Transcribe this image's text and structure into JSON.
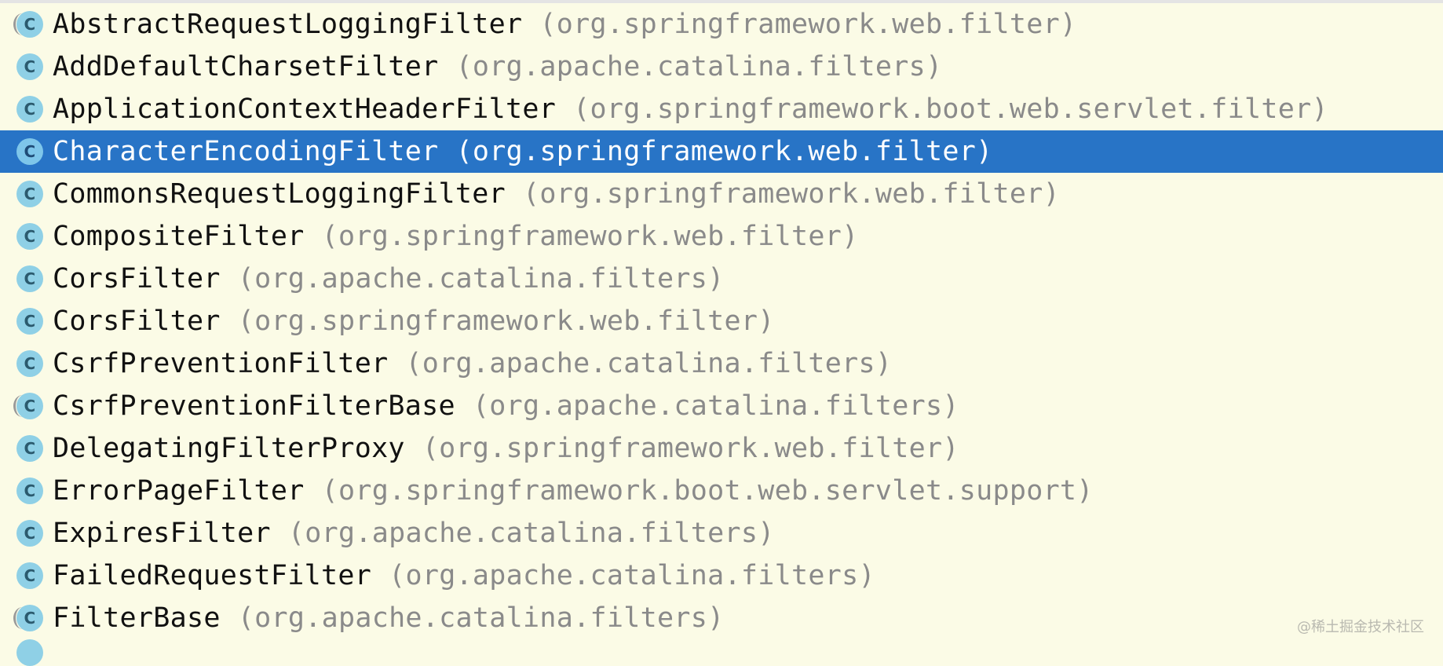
{
  "completion_popup": {
    "items": [
      {
        "icon": "class-abstract-icon",
        "icon_glyph": "C",
        "class_name": "AbstractRequestLoggingFilter",
        "package": "(org.springframework.web.filter)",
        "abstract": true
      },
      {
        "icon": "class-icon",
        "icon_glyph": "C",
        "class_name": "AddDefaultCharsetFilter",
        "package": "(org.apache.catalina.filters)"
      },
      {
        "icon": "class-icon",
        "icon_glyph": "C",
        "class_name": "ApplicationContextHeaderFilter",
        "package": "(org.springframework.boot.web.servlet.filter)"
      },
      {
        "icon": "class-icon",
        "icon_glyph": "C",
        "class_name": "CharacterEncodingFilter",
        "package": "(org.springframework.web.filter)",
        "selected": true
      },
      {
        "icon": "class-icon",
        "icon_glyph": "C",
        "class_name": "CommonsRequestLoggingFilter",
        "package": "(org.springframework.web.filter)"
      },
      {
        "icon": "class-icon",
        "icon_glyph": "C",
        "class_name": "CompositeFilter",
        "package": "(org.springframework.web.filter)"
      },
      {
        "icon": "class-icon",
        "icon_glyph": "C",
        "class_name": "CorsFilter",
        "package": "(org.apache.catalina.filters)"
      },
      {
        "icon": "class-icon",
        "icon_glyph": "C",
        "class_name": "CorsFilter",
        "package": "(org.springframework.web.filter)"
      },
      {
        "icon": "class-icon",
        "icon_glyph": "C",
        "class_name": "CsrfPreventionFilter",
        "package": "(org.apache.catalina.filters)"
      },
      {
        "icon": "class-abstract-icon",
        "icon_glyph": "C",
        "class_name": "CsrfPreventionFilterBase",
        "package": "(org.apache.catalina.filters)",
        "abstract": true
      },
      {
        "icon": "class-icon",
        "icon_glyph": "C",
        "class_name": "DelegatingFilterProxy",
        "package": "(org.springframework.web.filter)"
      },
      {
        "icon": "class-icon",
        "icon_glyph": "C",
        "class_name": "ErrorPageFilter",
        "package": "(org.springframework.boot.web.servlet.support)"
      },
      {
        "icon": "class-icon",
        "icon_glyph": "C",
        "class_name": "ExpiresFilter",
        "package": "(org.apache.catalina.filters)"
      },
      {
        "icon": "class-icon",
        "icon_glyph": "C",
        "class_name": "FailedRequestFilter",
        "package": "(org.apache.catalina.filters)"
      },
      {
        "icon": "class-abstract-icon",
        "icon_glyph": "C",
        "class_name": "FilterBase",
        "package": "(org.apache.catalina.filters)",
        "abstract": true
      }
    ]
  },
  "watermark": "@稀土掘金技术社区",
  "colors": {
    "background": "#fbfbe6",
    "selection": "#2874c6",
    "class_icon": "#8fd0e6",
    "package_text": "#8a8a8a"
  }
}
